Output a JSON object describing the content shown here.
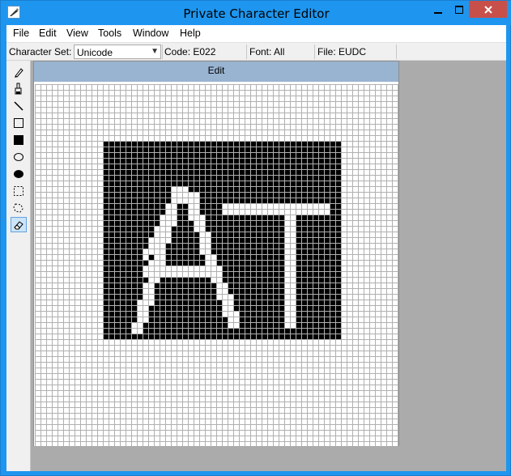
{
  "window": {
    "title": "Private Character Editor"
  },
  "menu": [
    "File",
    "Edit",
    "View",
    "Tools",
    "Window",
    "Help"
  ],
  "infobar": {
    "charset_label": "Character Set:",
    "charset_value": "Unicode",
    "code": "Code: E022",
    "font": "Font: All",
    "file": "File: EUDC"
  },
  "tools": [
    {
      "name": "pencil-icon"
    },
    {
      "name": "brush-icon"
    },
    {
      "name": "line-icon"
    },
    {
      "name": "hollow-rectangle-icon"
    },
    {
      "name": "filled-rectangle-icon"
    },
    {
      "name": "hollow-ellipse-icon"
    },
    {
      "name": "filled-ellipse-icon"
    },
    {
      "name": "rectangular-selection-icon"
    },
    {
      "name": "freeform-selection-icon"
    },
    {
      "name": "eraser-icon",
      "selected": true
    }
  ],
  "edit_panel": {
    "title": "Edit"
  },
  "colors": {
    "titlebar": "#1e96ef",
    "close_button": "#c7504b",
    "edit_header": "#99b4d1",
    "workspace": "#ababab",
    "pixel_on": "#000000",
    "grid_line": "#b0b0b0"
  }
}
